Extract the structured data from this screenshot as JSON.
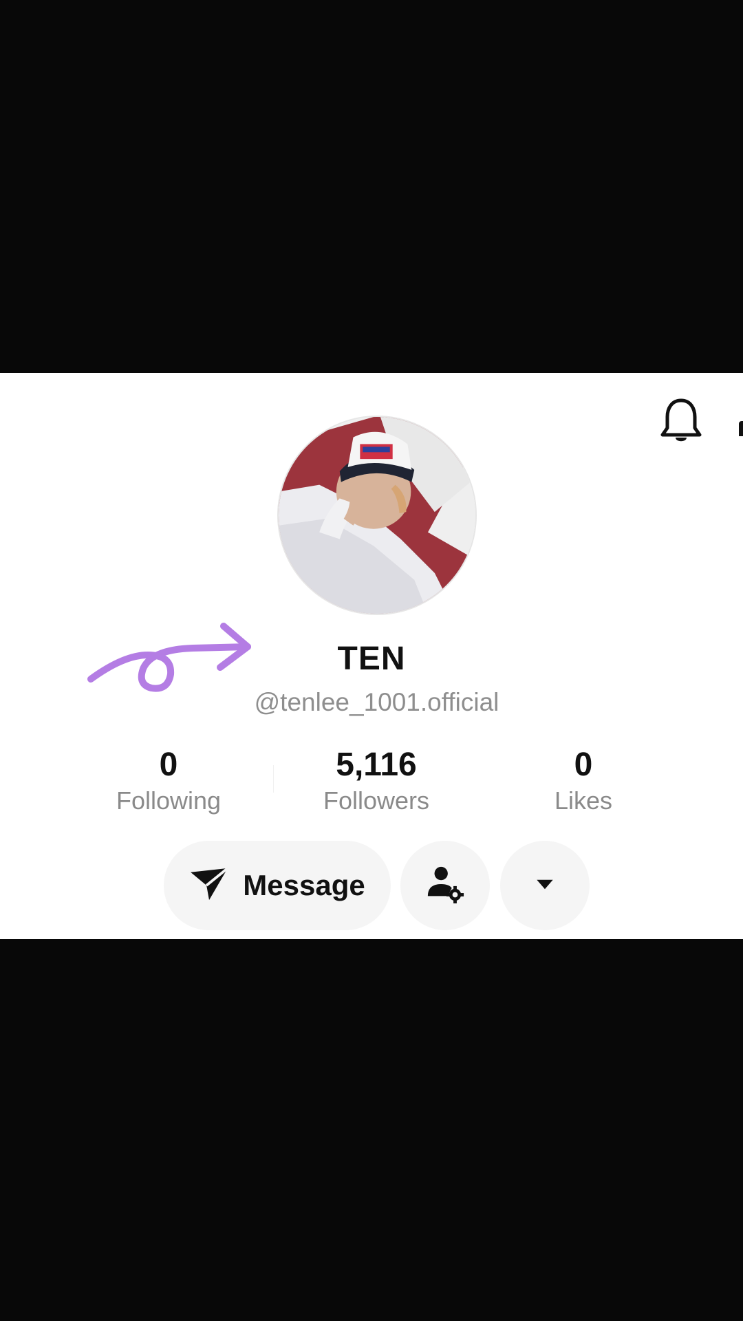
{
  "profile": {
    "display_name": "TEN",
    "username": "@tenlee_1001.official"
  },
  "stats": {
    "following": {
      "value": "0",
      "label": "Following"
    },
    "followers": {
      "value": "5,116",
      "label": "Followers"
    },
    "likes": {
      "value": "0",
      "label": "Likes"
    }
  },
  "actions": {
    "message_label": "Message"
  },
  "icons": {
    "notification": "bell-icon",
    "message": "paper-plane-icon",
    "friend_settings": "user-gear-icon",
    "more": "caret-down-icon"
  },
  "colors": {
    "background": "#ffffff",
    "letterbox": "#080808",
    "primary_text": "#111111",
    "secondary_text": "#8e8e8e",
    "button_bg": "#f5f5f5",
    "doodle": "#b47de4"
  }
}
